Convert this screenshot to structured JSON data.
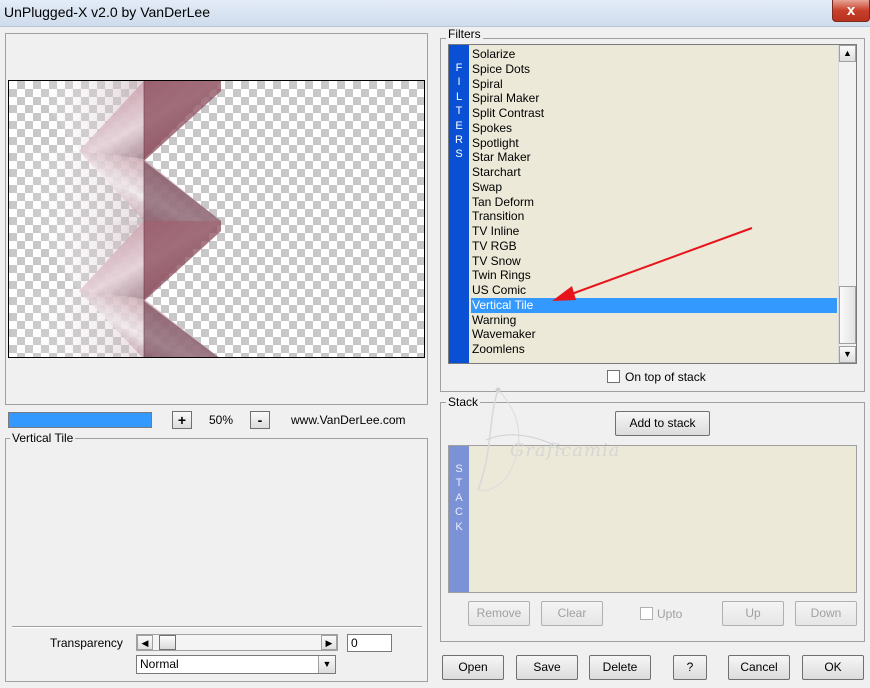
{
  "window": {
    "title": "UnPlugged-X v2.0 by VanDerLee",
    "close_glyph": "x"
  },
  "preview": {
    "zoom_plus": "+",
    "zoom_value": "50%",
    "zoom_minus": "-",
    "website": "www.VanDerLee.com",
    "progress_fraction": 1.0
  },
  "params": {
    "title": "Vertical Tile",
    "transparency_label": "Transparency",
    "transparency_value": "0",
    "blend_mode": "Normal"
  },
  "filters": {
    "title": "Filters",
    "strip_letters": [
      "F",
      "I",
      "L",
      "T",
      "E",
      "R",
      "S"
    ],
    "items": [
      "Solarize",
      "Spice Dots",
      "Spiral",
      "Spiral Maker",
      "Split Contrast",
      "Spokes",
      "Spotlight",
      "Star Maker",
      "Starchart",
      "Swap",
      "Tan Deform",
      "Transition",
      "TV Inline",
      "TV RGB",
      "TV Snow",
      "Twin Rings",
      "US Comic",
      "Vertical Tile",
      "Warning",
      "Wavemaker",
      "Zoomlens"
    ],
    "selected": "Vertical Tile",
    "on_top_label": "On top of stack",
    "on_top_checked": false
  },
  "stack": {
    "title": "Stack",
    "add_button": "Add to stack",
    "strip_letters": [
      "S",
      "T",
      "A",
      "C",
      "K"
    ],
    "remove_button": "Remove",
    "clear_button": "Clear",
    "upto_label": "Upto",
    "up_button": "Up",
    "down_button": "Down"
  },
  "footer": {
    "open_button": "Open",
    "save_button": "Save",
    "delete_button": "Delete",
    "help_button": "?",
    "cancel_button": "Cancel",
    "ok_button": "OK"
  },
  "watermark": {
    "text": "Graficamia"
  },
  "colors": {
    "selection": "#3399ff",
    "filters_strip": "#0a50d4",
    "stack_strip": "#7b93d6",
    "list_bg": "#ece9d8",
    "annotation_arrow": "#e8141c",
    "tile_pink": "#8a4a5a"
  }
}
